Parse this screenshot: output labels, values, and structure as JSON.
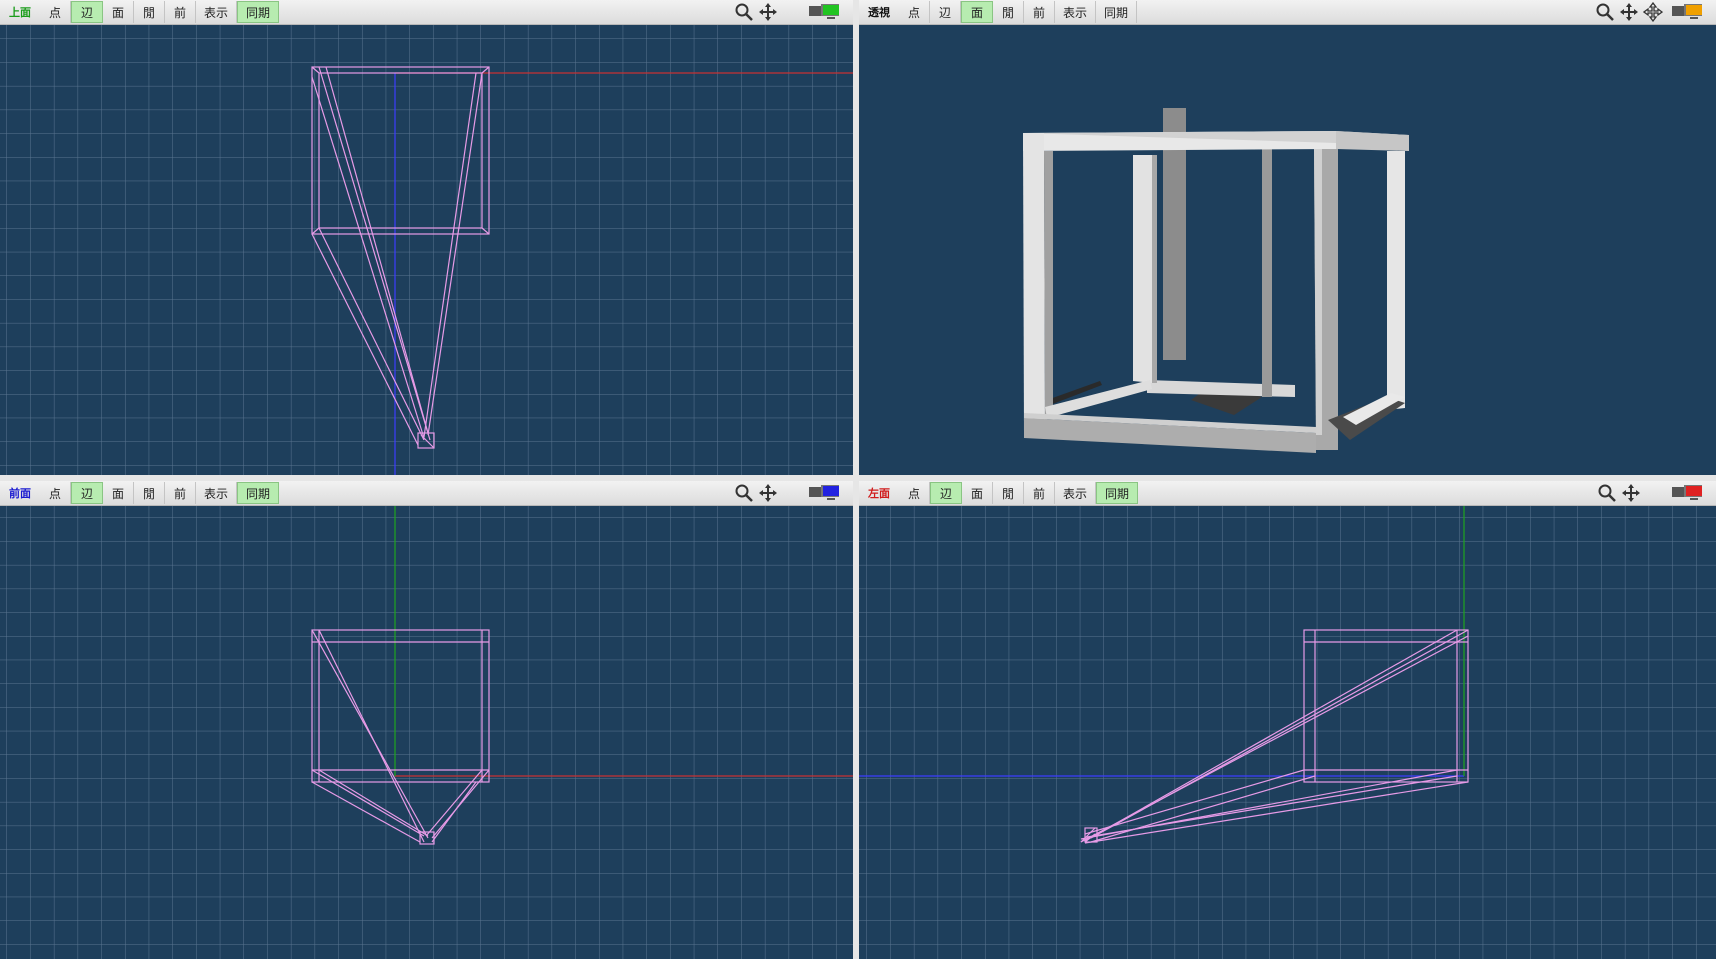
{
  "toolbar_buttons": [
    "点",
    "辺",
    "面",
    "閒",
    "前",
    "表示",
    "同期"
  ],
  "viewports": [
    {
      "id": "top",
      "title": "上面",
      "title_color": "#1a9c1a",
      "monitor_color": "#22c422",
      "active_buttons": [
        "辺",
        "同期"
      ]
    },
    {
      "id": "perspective",
      "title": "透視",
      "title_color": "#111111",
      "monitor_color": "#f0a000",
      "active_buttons": [
        "面"
      ]
    },
    {
      "id": "front",
      "title": "前面",
      "title_color": "#1a1ad0",
      "monitor_color": "#2222e0",
      "active_buttons": [
        "辺",
        "同期"
      ]
    },
    {
      "id": "left",
      "title": "左面",
      "title_color": "#d01a1a",
      "monitor_color": "#e02222",
      "active_buttons": [
        "辺",
        "同期"
      ]
    }
  ],
  "colors": {
    "canvas_bg": "#1e3f5c",
    "grid": "#5a7590",
    "wire": "#e79be7",
    "axis_red": "#c83232",
    "axis_blue": "#3c3cff",
    "axis_green": "#1fa51f",
    "button_active": "#b7ecb0"
  }
}
